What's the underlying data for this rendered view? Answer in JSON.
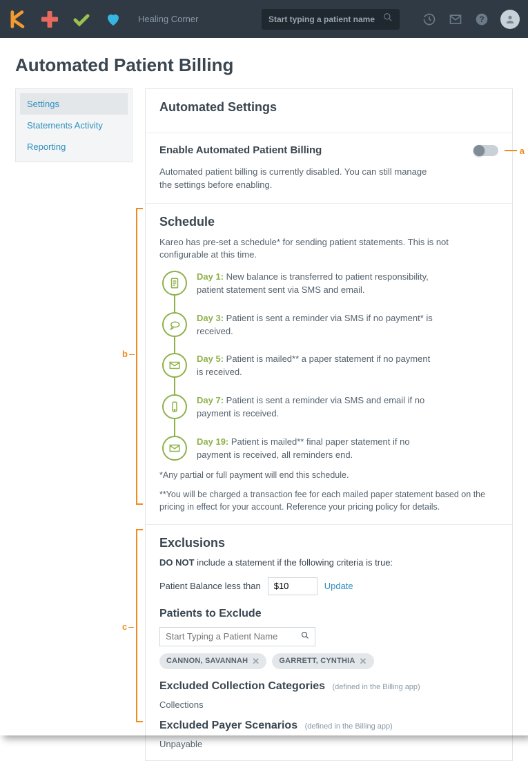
{
  "topbar": {
    "practice_name": "Healing Corner",
    "search_placeholder": "Start typing a patient name"
  },
  "page_title": "Automated Patient Billing",
  "sidebar": {
    "items": [
      {
        "label": "Settings"
      },
      {
        "label": "Statements Activity"
      },
      {
        "label": "Reporting"
      }
    ]
  },
  "settings_section_title": "Automated Settings",
  "enable": {
    "title": "Enable Automated Patient Billing",
    "desc": "Automated patient billing is currently disabled. You can still manage the settings before enabling."
  },
  "callouts": {
    "a": "a",
    "b": "b",
    "c": "c"
  },
  "schedule": {
    "title": "Schedule",
    "intro": "Kareo has pre-set a schedule* for sending patient statements. This is not configurable at this time.",
    "steps": [
      {
        "day": "Day 1:",
        "text": " New balance is transferred to patient responsibility, patient statement sent via SMS and email."
      },
      {
        "day": "Day 3:",
        "text": " Patient is sent a reminder via SMS if no payment* is received."
      },
      {
        "day": "Day 5:",
        "text": " Patient is mailed** a paper statement if no payment is received."
      },
      {
        "day": "Day 7:",
        "text": " Patient is sent a reminder via SMS and email if no payment is received."
      },
      {
        "day": "Day 19:",
        "text": " Patient is mailed** final paper statement if no payment is received, all reminders end."
      }
    ],
    "footnote1": "*Any partial or full payment will end this schedule.",
    "footnote2": "**You will be charged a transaction fee for each mailed paper statement based on the pricing in effect for your account. Reference your pricing policy for details."
  },
  "exclusions": {
    "title": "Exclusions",
    "intro_bold": "DO NOT",
    "intro_rest": " include a statement if the following criteria is true:",
    "balance_label": "Patient Balance less than",
    "balance_value": "$10",
    "update_label": "Update",
    "patients_title": "Patients to Exclude",
    "patient_search_placeholder": "Start Typing a Patient Name",
    "chips": [
      {
        "name": "CANNON, SAVANNAH"
      },
      {
        "name": "GARRETT, CYNTHIA"
      }
    ],
    "excluded_categories_title": "Excluded Collection Categories",
    "defined_note": "(defined in the Billing app)",
    "excluded_categories_value": "Collections",
    "excluded_payers_title": "Excluded Payer Scenarios",
    "excluded_payers_value": "Unpayable"
  }
}
